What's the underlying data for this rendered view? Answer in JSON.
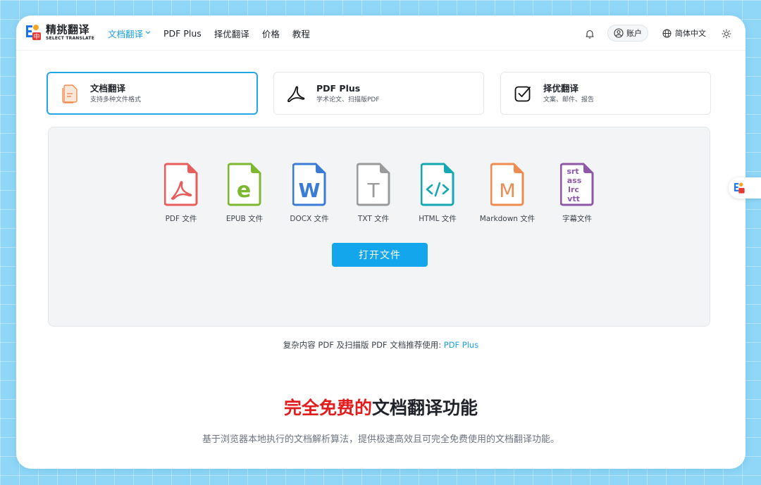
{
  "brand": {
    "name": "精挑翻译",
    "subtitle": "SELECT TRANSLATE"
  },
  "nav": {
    "items": [
      {
        "label": "文档翻译",
        "active": true,
        "has_dropdown": true
      },
      {
        "label": "PDF Plus"
      },
      {
        "label": "择优翻译"
      },
      {
        "label": "价格"
      },
      {
        "label": "教程"
      }
    ]
  },
  "toolbar": {
    "notification_icon": "bell-icon",
    "account_label": "账户",
    "language_label": "简体中文",
    "theme_icon": "sun-icon"
  },
  "modes": [
    {
      "title": "文档翻译",
      "desc": "支持多种文件格式",
      "icon": "document-icon",
      "active": true
    },
    {
      "title": "PDF Plus",
      "desc": "学术论文、扫描版PDF",
      "icon": "pdf-icon"
    },
    {
      "title": "择优翻译",
      "desc": "文案、邮件、报告",
      "icon": "checkbox-icon"
    }
  ],
  "file_types": [
    {
      "label": "PDF 文件",
      "color": "#e85d5d"
    },
    {
      "label": "EPUB 文件",
      "color": "#7cb82f"
    },
    {
      "label": "DOCX 文件",
      "color": "#3a7bd5"
    },
    {
      "label": "TXT 文件",
      "color": "#9a9a9a"
    },
    {
      "label": "HTML 文件",
      "color": "#14a8b5"
    },
    {
      "label": "Markdown 文件",
      "color": "#f08b50"
    },
    {
      "label": "字幕文件",
      "color": "#8e57a8"
    }
  ],
  "subtitle_formats": [
    "srt",
    "ass",
    "lrc",
    "vtt"
  ],
  "open_button": "打开文件",
  "hint": {
    "text": "复杂内容 PDF 及扫描版 PDF 文档推荐使用:",
    "link": "PDF Plus"
  },
  "headline": {
    "highlight": "完全免费的",
    "rest": "文档翻译功能"
  },
  "subline": "基于浏览器本地执行的文档解析算法，提供极速高效且可完全免费使用的文档翻译功能。",
  "colors": {
    "accent": "#1ba1e6",
    "button": "#13a6ec",
    "highlight_red": "#e21d1d"
  }
}
